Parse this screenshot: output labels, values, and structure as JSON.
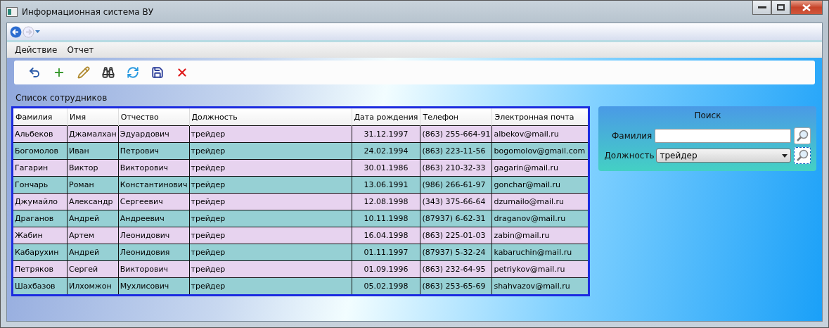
{
  "window": {
    "title": "Информационная система ВУ"
  },
  "menu": [
    "Действие",
    "Отчет"
  ],
  "list_title": "Список сотрудников",
  "table": {
    "columns": [
      "Фамилия",
      "Имя",
      "Отчество",
      "Должность",
      "Дата рождения",
      "Телефон",
      "Электронная почта"
    ],
    "rows": [
      [
        "Альбеков",
        "Джамалхан",
        "Эдуардович",
        "трейдер",
        "31.12.1997",
        "(863) 255-664-91",
        "albekov@mail.ru"
      ],
      [
        "Богомолов",
        "Иван",
        "Петрович",
        "трейдер",
        "24.02.1994",
        "(863) 223-11-56",
        "bogomolov@gmail.com"
      ],
      [
        "Гагарин",
        "Виктор",
        "Викторович",
        "трейдер",
        "30.01.1986",
        "(863) 210-32-33",
        "gagarin@mail.ru"
      ],
      [
        "Гончарь",
        "Роман",
        "Константинович",
        "трейдер",
        "13.06.1991",
        "(986) 266-61-97",
        "gonchar@mail.ru"
      ],
      [
        "Джумайло",
        "Александр",
        "Сергеевич",
        "трейдер",
        "12.08.1998",
        "(343) 375-66-64",
        "dzumailo@mail.ru"
      ],
      [
        "Драганов",
        "Андрей",
        "Андреевич",
        "трейдер",
        "10.11.1998",
        "(87937) 6-62-31",
        "draganov@mail.ru"
      ],
      [
        "Жабин",
        "Артем",
        "Леонидович",
        "трейдер",
        "16.04.1998",
        "(863) 225-01-03",
        "zabin@mail.ru"
      ],
      [
        "Кабарухин",
        "Андрей",
        "Леонидовия",
        "трейдер",
        "01.11.1997",
        "(87937) 5-32-24",
        "kabaruchin@mail.ru"
      ],
      [
        "Петряков",
        "Сергей",
        "Викторович",
        "трейдер",
        "01.09.1996",
        "(863) 232-64-95",
        "petriykov@mail.ru"
      ],
      [
        "Шахбазов",
        "Илхомжон",
        "Мухлисович",
        "трейдер",
        "05.02.1998",
        "(863) 253-65-69",
        "shahvazov@mail.ru"
      ]
    ]
  },
  "search": {
    "title": "Поиск",
    "fields": [
      {
        "kind": "text",
        "label": "Фамилия"
      },
      {
        "kind": "select",
        "label": "Должность",
        "value": "трейдер"
      }
    ]
  }
}
